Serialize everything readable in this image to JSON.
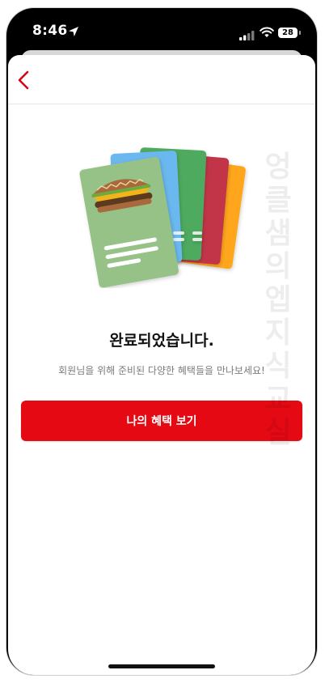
{
  "status_bar": {
    "time": "8:46",
    "battery": "28",
    "icons": [
      "location-arrow-icon",
      "signal-bars-icon",
      "wifi-icon",
      "battery-icon"
    ]
  },
  "nav": {
    "back_icon": "chevron-left-icon",
    "accent_color": "#d10a11"
  },
  "hero": {
    "illustration": "stacked-benefit-cards-with-burger",
    "card_colors": [
      "#ffa61a",
      "#c2344a",
      "#4eaa5f",
      "#6ab8ef",
      "#97c287"
    ]
  },
  "main": {
    "title": "완료되었습니다.",
    "subtitle": "회원님을 위해 준비된 다양한 혜택들을 만나보세요!",
    "cta_label": "나의 혜택 보기",
    "cta_color": "#e50914"
  },
  "watermark": {
    "text": "엉클샘의엡지식교실"
  }
}
